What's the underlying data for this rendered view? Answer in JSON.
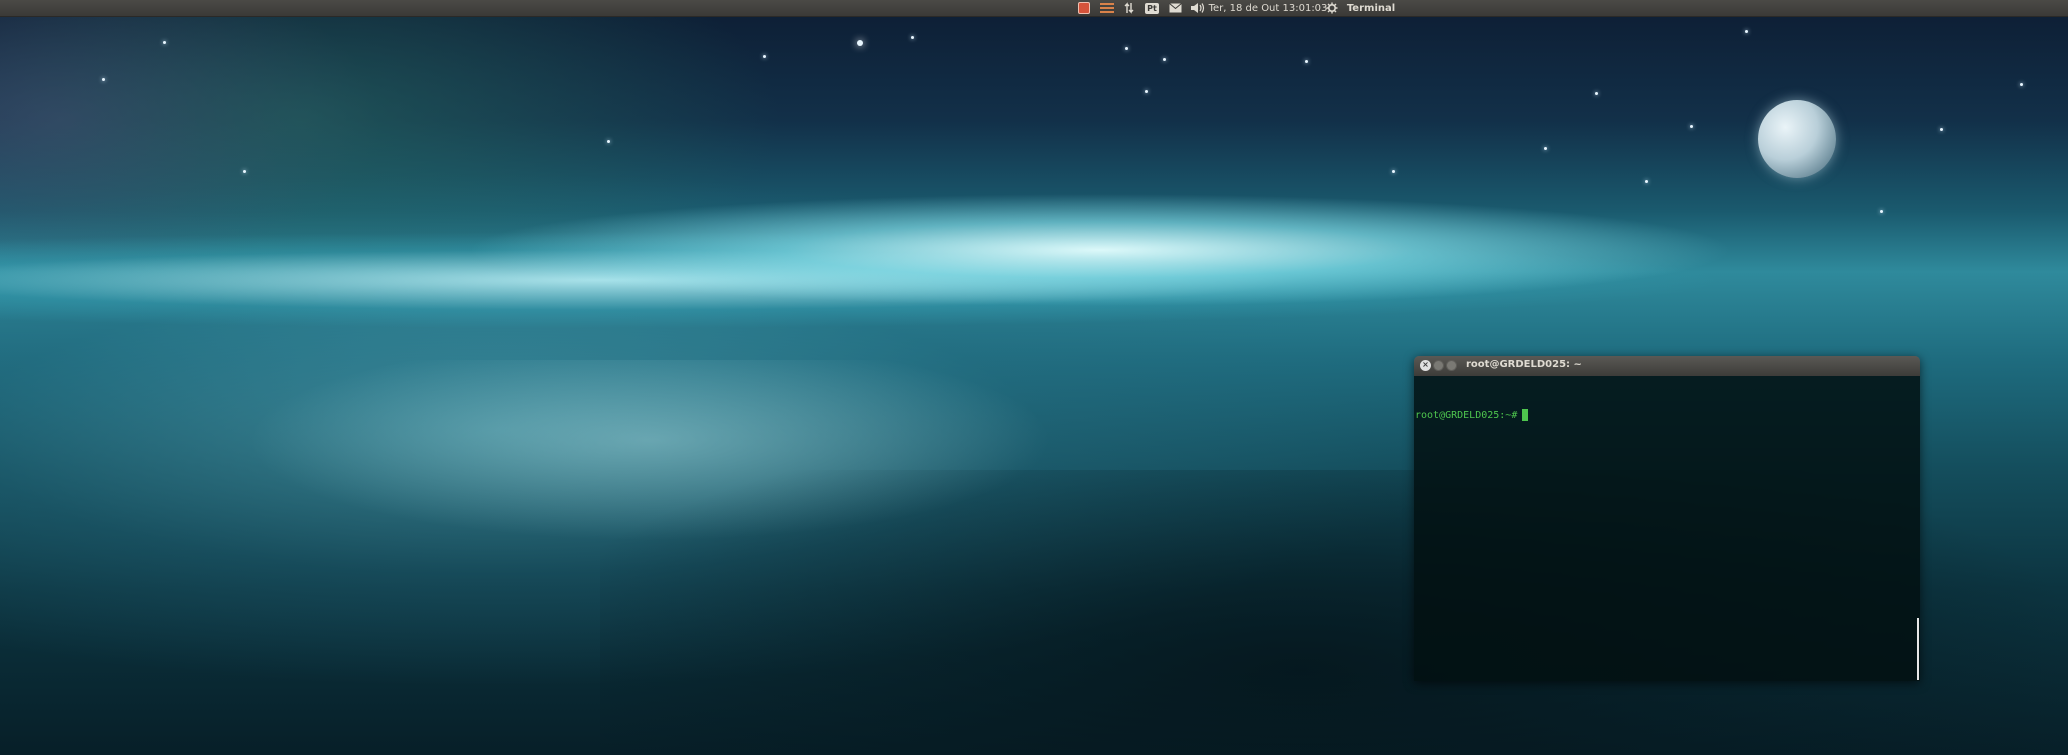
{
  "panel": {
    "keyboard_layout": "Pt",
    "clock": "Ter, 18 de Out 13:01:03",
    "active_app": "Terminal",
    "icons": {
      "app_indicator": "app-indicator-icon",
      "update": "update-icon",
      "network": "network-icon",
      "mail": "mail-icon",
      "volume": "volume-icon",
      "settings": "gear-icon"
    }
  },
  "terminal": {
    "title": "root@GRDELD025: ~",
    "prompt": "root@GRDELD025:~#",
    "prompt_color": "#4ec54e",
    "buttons": {
      "close": "close-icon",
      "minimize": "minimize-icon",
      "maximize": "maximize-icon"
    }
  },
  "colors": {
    "panel_bg": "#3b3a37",
    "panel_text": "#dfdbd2",
    "terminal_bg": "#021012"
  }
}
